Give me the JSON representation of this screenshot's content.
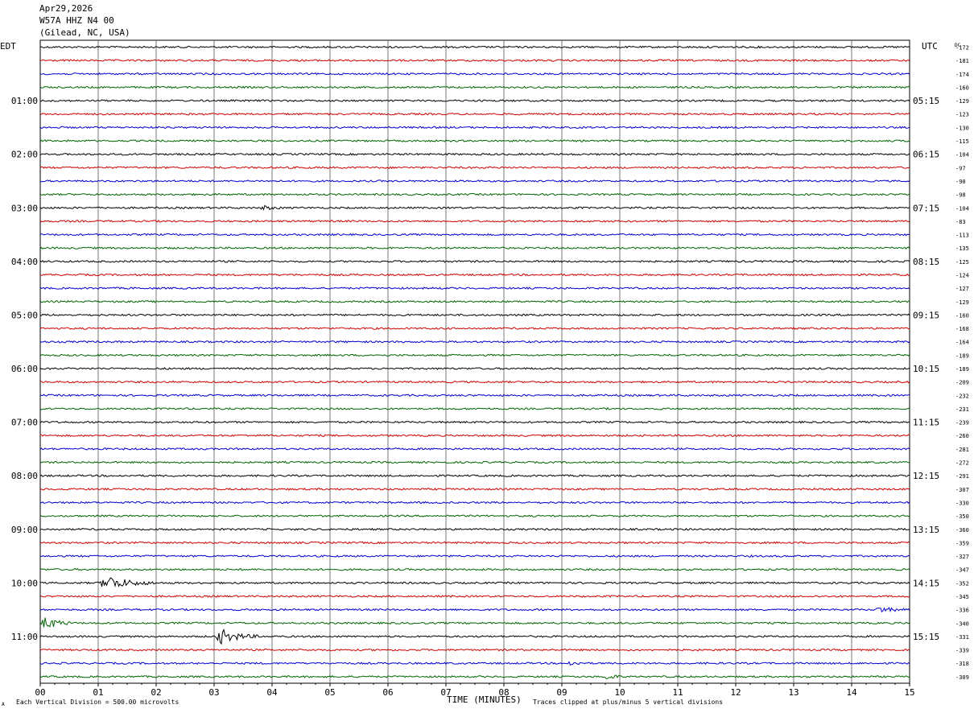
{
  "header": {
    "date": "Apr29,2026",
    "station": "W57A HHZ N4 00",
    "location": "(Gilead, NC, USA)"
  },
  "left_tz": "EDT",
  "right_tz": "UTC",
  "dc_label": "DC",
  "footer": {
    "division": "Each Vertical Division =  500.00 microvolts",
    "clip": "Traces clipped at plus/minus 5 vertical divisions",
    "corner_mark": "A"
  },
  "colors": [
    "#000000",
    "#cc0000",
    "#0000cc",
    "#006600"
  ],
  "chart_data": {
    "type": "line",
    "subtype": "helicorder",
    "xlabel": "TIME (MINUTES)",
    "xlim": [
      0,
      15
    ],
    "x_ticks": [
      "00",
      "01",
      "02",
      "03",
      "04",
      "05",
      "06",
      "07",
      "08",
      "09",
      "10",
      "11",
      "12",
      "13",
      "14",
      "15"
    ],
    "rows": 48,
    "minutes_per_row": 15,
    "left_time_labels": [
      "01:00",
      "02:00",
      "03:00",
      "04:00",
      "05:00",
      "06:00",
      "07:00",
      "08:00",
      "09:00",
      "10:00",
      "11:00"
    ],
    "right_time_labels": [
      "05:15",
      "06:15",
      "07:15",
      "08:15",
      "09:15",
      "10:15",
      "11:15",
      "12:15",
      "13:15",
      "14:15",
      "15:15"
    ],
    "dc_offsets": [
      "-172",
      "-181",
      "-174",
      "-160",
      "-129",
      "-123",
      "-130",
      "-115",
      "-104",
      "-97",
      "-90",
      "-98",
      "-104",
      "-83",
      "-113",
      "-135",
      "-125",
      "-124",
      "-127",
      "-129",
      "-160",
      "-168",
      "-164",
      "-189",
      "-189",
      "-209",
      "-232",
      "-231",
      "-239",
      "-260",
      "-281",
      "-272",
      "-291",
      "-307",
      "-330",
      "-350",
      "-360",
      "-359",
      "-327",
      "-347",
      "-352",
      "-345",
      "-336",
      "-340",
      "-331",
      "-339",
      "-318",
      "-309"
    ],
    "events": [
      {
        "row": 12,
        "minute": 3.8,
        "duration": 0.4,
        "amplitude": 2.2
      },
      {
        "row": 40,
        "minute": 1.0,
        "duration": 1.0,
        "amplitude": 8
      },
      {
        "row": 42,
        "minute": 14.4,
        "duration": 0.6,
        "amplitude": 3
      },
      {
        "row": 43,
        "minute": 0.0,
        "duration": 0.6,
        "amplitude": 7
      },
      {
        "row": 44,
        "minute": 3.0,
        "duration": 0.8,
        "amplitude": 8
      },
      {
        "row": 46,
        "minute": 9.1,
        "duration": 0.3,
        "amplitude": 2.5
      },
      {
        "row": 47,
        "minute": 9.7,
        "duration": 0.4,
        "amplitude": 3
      }
    ]
  }
}
